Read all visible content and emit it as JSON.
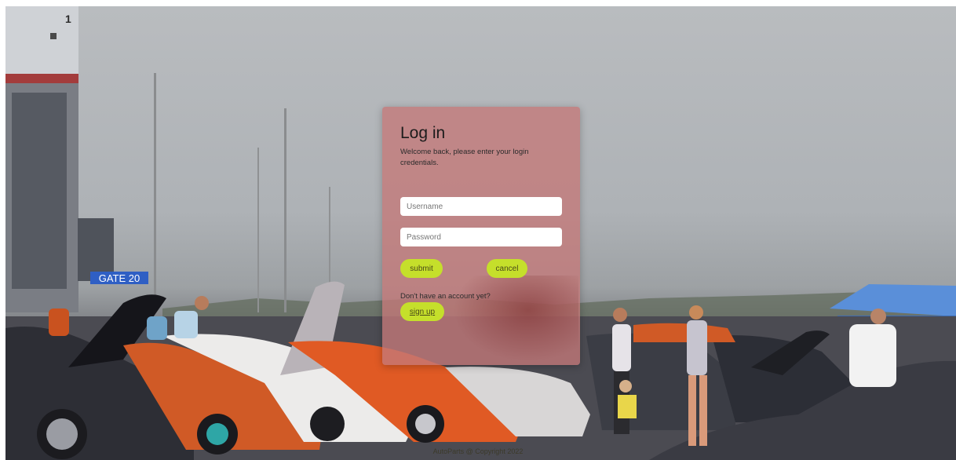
{
  "background": {
    "gate_sign": "GATE 20",
    "corner_mark": "1"
  },
  "login": {
    "title": "Log in",
    "subtitle": "Welcome back, please enter your login credentials.",
    "username_placeholder": "Username",
    "password_placeholder": "Password",
    "submit_label": "submit",
    "cancel_label": "cancel",
    "no_account_text": "Don't have an account yet?",
    "signup_label": "sign up"
  },
  "footer": {
    "copyright": "AutoParts @ Copyright 2022"
  },
  "colors": {
    "card": "#c47878",
    "button": "#c5df2b",
    "gate_sign": "#2f5fc4",
    "tent": "#5a8fd9"
  }
}
